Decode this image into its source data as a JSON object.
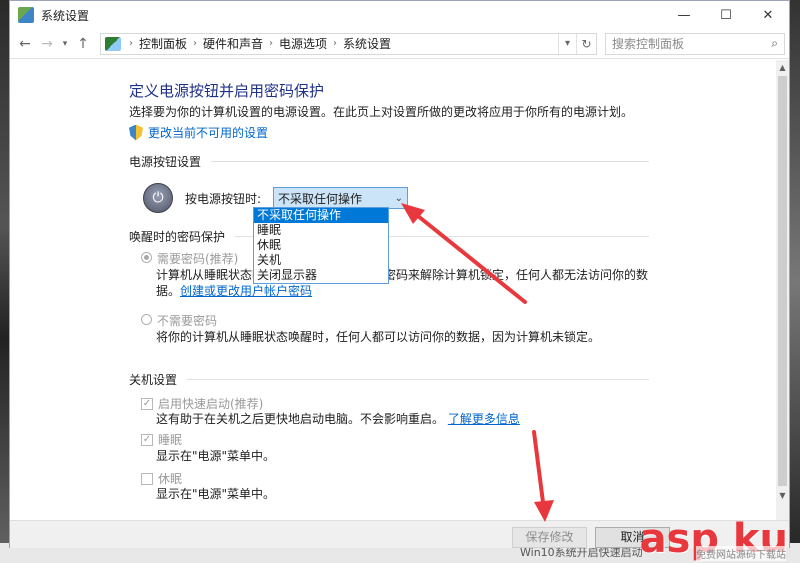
{
  "window": {
    "title": "系统设置"
  },
  "controls": {
    "minimize": "—",
    "maximize": "☐",
    "close": "✕"
  },
  "address": {
    "crumbs": [
      "控制面板",
      "硬件和声音",
      "电源选项",
      "系统设置"
    ],
    "search_placeholder": "搜索控制面板"
  },
  "page": {
    "heading": "定义电源按钮并启用密码保护",
    "description": "选择要为你的计算机设置的电源设置。在此页上对设置所做的更改将应用于你所有的电源计划。",
    "change_link": "更改当前不可用的设置"
  },
  "power_buttons": {
    "section": "电源按钮设置",
    "label": "按电源按钮时:",
    "selected": "不采取任何操作",
    "options": [
      "不采取任何操作",
      "睡眠",
      "休眠",
      "关机",
      "关闭显示器"
    ]
  },
  "wake_password": {
    "section": "唤醒时的密码保护",
    "require": {
      "label": "需要密码(推荐)",
      "desc_line1": "计算机从睡眠状态唤醒时，必须输入正确的密码来解除计算机锁定，任何人都无法访问你的数",
      "desc_line2_prefix": "据。",
      "link": "创建或更改用户帐户密码"
    },
    "no_require": {
      "label": "不需要密码",
      "desc": "将你的计算机从睡眠状态唤醒时，任何人都可以访问你的数据，因为计算机未锁定。"
    }
  },
  "shutdown": {
    "section": "关机设置",
    "fast_startup": {
      "label": "启用快速启动(推荐)",
      "desc": "这有助于在关机之后更快地启动电脑。不会影响重启。",
      "link": "了解更多信息"
    },
    "sleep": {
      "label": "睡眠",
      "desc": "显示在\"电源\"菜单中。"
    },
    "hibernate": {
      "label": "休眠",
      "desc": "显示在\"电源\"菜单中。"
    }
  },
  "footer": {
    "save": "保存修改",
    "cancel": "取消"
  },
  "taskbar_text": "Win10系统开启快速启动",
  "watermark": {
    "main": "asp ku",
    "sub": "免费网站源码下载站"
  },
  "colors": {
    "accent": "#0078d7",
    "heading": "#1e3287",
    "link": "#0066cc",
    "arrow": "#e8383d"
  }
}
